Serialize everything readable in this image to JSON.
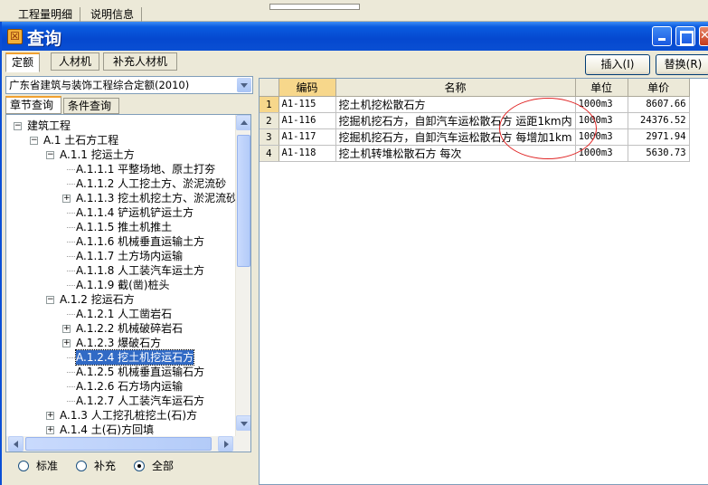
{
  "background": {
    "tabs": [
      "工程量明细",
      "说明信息"
    ]
  },
  "window": {
    "title": "查询",
    "title_icon": "app-icon",
    "controls": {
      "minimize": "minimize-icon",
      "maximize": "maximize-icon",
      "close": "close-icon"
    }
  },
  "main_tabs": [
    "定额",
    "人材机",
    "补充人材机"
  ],
  "buttons": {
    "insert": "插入(I)",
    "replace": "替换(R)"
  },
  "left": {
    "combo_value": "广东省建筑与装饰工程综合定额(2010)",
    "sub_tabs": [
      "章节查询",
      "条件查询"
    ],
    "tree": [
      {
        "label": "建筑工程",
        "level": 0,
        "toggle": "−"
      },
      {
        "label": "A.1 土石方工程",
        "level": 1,
        "toggle": "−"
      },
      {
        "label": "A.1.1 挖运土方",
        "level": 2,
        "toggle": "−"
      },
      {
        "label": "A.1.1.1 平整场地、原土打夯",
        "level": 3,
        "toggle": ""
      },
      {
        "label": "A.1.1.2 人工挖土方、淤泥流砂",
        "level": 3,
        "toggle": ""
      },
      {
        "label": "A.1.1.3 挖土机挖土方、淤泥流砂",
        "level": 3,
        "toggle": "+"
      },
      {
        "label": "A.1.1.4 铲运机铲运土方",
        "level": 3,
        "toggle": ""
      },
      {
        "label": "A.1.1.5 推土机推土",
        "level": 3,
        "toggle": ""
      },
      {
        "label": "A.1.1.6 机械垂直运输土方",
        "level": 3,
        "toggle": ""
      },
      {
        "label": "A.1.1.7 土方场内运输",
        "level": 3,
        "toggle": ""
      },
      {
        "label": "A.1.1.8 人工装汽车运土方",
        "level": 3,
        "toggle": ""
      },
      {
        "label": "A.1.1.9 截(凿)桩头",
        "level": 3,
        "toggle": ""
      },
      {
        "label": "A.1.2 挖运石方",
        "level": 2,
        "toggle": "−"
      },
      {
        "label": "A.1.2.1 人工凿岩石",
        "level": 3,
        "toggle": ""
      },
      {
        "label": "A.1.2.2 机械破碎岩石",
        "level": 3,
        "toggle": "+"
      },
      {
        "label": "A.1.2.3 爆破石方",
        "level": 3,
        "toggle": "+"
      },
      {
        "label": "A.1.2.4 挖土机挖运石方",
        "level": 3,
        "toggle": "",
        "selected": true
      },
      {
        "label": "A.1.2.5 机械垂直运输石方",
        "level": 3,
        "toggle": ""
      },
      {
        "label": "A.1.2.6 石方场内运输",
        "level": 3,
        "toggle": ""
      },
      {
        "label": "A.1.2.7 人工装汽车运石方",
        "level": 3,
        "toggle": ""
      },
      {
        "label": "A.1.3 人工挖孔桩挖土(石)方",
        "level": 2,
        "toggle": "+"
      },
      {
        "label": "A.1.4 土(石)方回填",
        "level": 2,
        "toggle": "+"
      }
    ],
    "radios": [
      {
        "label": "标准",
        "checked": false
      },
      {
        "label": "补充",
        "checked": false
      },
      {
        "label": "全部",
        "checked": true
      }
    ]
  },
  "grid": {
    "headers": [
      "",
      "编码",
      "名称",
      "单位",
      "单价"
    ],
    "rows": [
      {
        "n": "1",
        "code": "A1-115",
        "name": "挖土机挖松散石方",
        "unit": "1000m3",
        "price": "8607.66"
      },
      {
        "n": "2",
        "code": "A1-116",
        "name": "挖掘机挖石方，自卸汽车运松散石方  运距1km内",
        "unit": "1000m3",
        "price": "24376.52"
      },
      {
        "n": "3",
        "code": "A1-117",
        "name": "挖掘机挖石方，自卸汽车运松散石方  每增加1km",
        "unit": "1000m3",
        "price": "2971.94"
      },
      {
        "n": "4",
        "code": "A1-118",
        "name": "挖土机转堆松散石方  每次",
        "unit": "1000m3",
        "price": "5630.73"
      }
    ]
  }
}
